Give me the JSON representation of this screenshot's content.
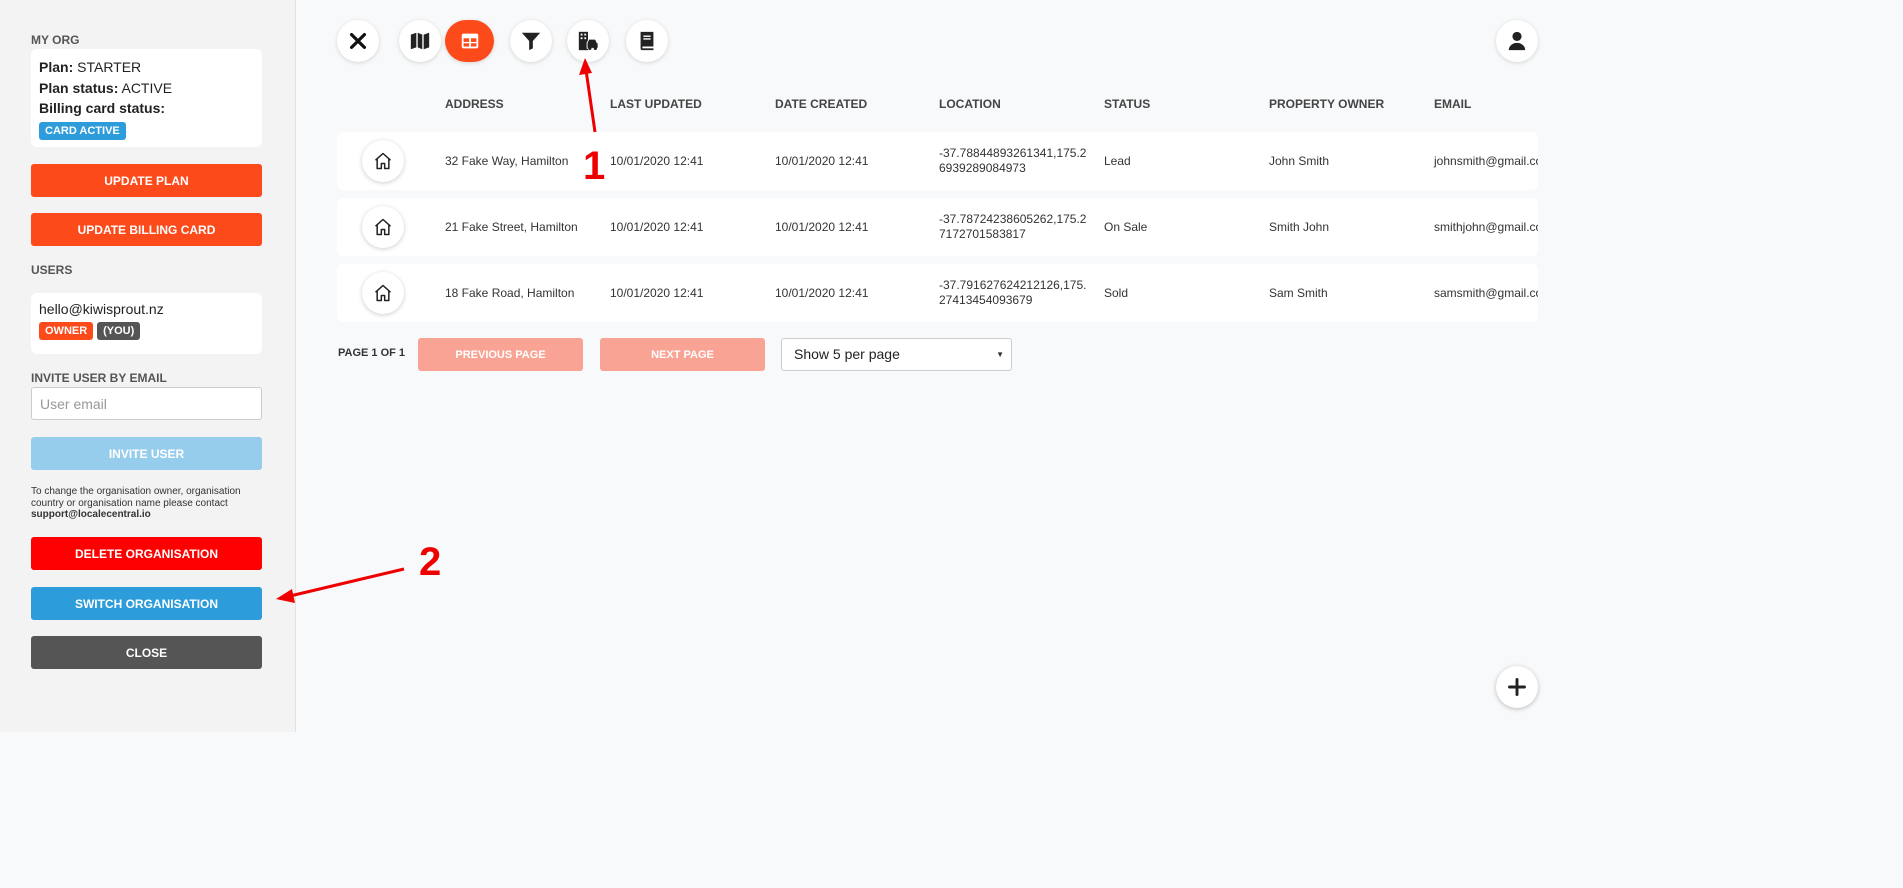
{
  "sidebar": {
    "my_org_label": "MY ORG",
    "plan_label": "Plan:",
    "plan_value": "STARTER",
    "plan_status_label": "Plan status:",
    "plan_status_value": "ACTIVE",
    "billing_status_label": "Billing card status:",
    "billing_badge": "CARD ACTIVE",
    "update_plan_button": "UPDATE PLAN",
    "update_billing_button": "UPDATE BILLING CARD",
    "users_label": "USERS",
    "user_email": "hello@kiwisprout.nz",
    "owner_badge": "OWNER",
    "you_badge": "(YOU)",
    "invite_label": "INVITE USER BY EMAIL",
    "invite_placeholder": "User email",
    "invite_button": "INVITE USER",
    "help_text": "To change the organisation owner, organisation country or organisation name please contact",
    "help_email": "support@localecentral.io",
    "delete_button": "DELETE ORGANISATION",
    "switch_button": "SWITCH ORGANISATION",
    "close_button": "CLOSE"
  },
  "toolbar": {
    "icons": [
      "close-icon",
      "map-icon",
      "table-icon",
      "filter-icon",
      "building-car-icon",
      "book-icon"
    ],
    "active": "table-icon",
    "user_icon": "user-icon"
  },
  "table": {
    "columns": [
      "ADDRESS",
      "LAST UPDATED",
      "DATE CREATED",
      "LOCATION",
      "STATUS",
      "PROPERTY OWNER",
      "EMAIL"
    ],
    "rows": [
      {
        "address": "32 Fake Way, Hamilton",
        "last_updated": "10/01/2020 12:41",
        "date_created": "10/01/2020 12:41",
        "location": "-37.78844893261341,175.26939289084973",
        "status": "Lead",
        "owner": "John Smith",
        "email": "johnsmith@gmail.com"
      },
      {
        "address": "21 Fake Street, Hamilton",
        "last_updated": "10/01/2020 12:41",
        "date_created": "10/01/2020 12:41",
        "location": "-37.78724238605262,175.27172701583817",
        "status": "On Sale",
        "owner": "Smith John",
        "email": "smithjohn@gmail.com"
      },
      {
        "address": "18 Fake Road, Hamilton",
        "last_updated": "10/01/2020 12:41",
        "date_created": "10/01/2020 12:41",
        "location": "-37.791627624212126,175.27413454093679",
        "status": "Sold",
        "owner": "Sam Smith",
        "email": "samsmith@gmail.com"
      }
    ]
  },
  "pagination": {
    "label": "PAGE 1 OF 1",
    "previous": "PREVIOUS PAGE",
    "next": "NEXT PAGE",
    "per_page": "Show 5 per page"
  },
  "annotations": {
    "one": "1",
    "two": "2"
  },
  "colors": {
    "accent": "#fc4a1a",
    "blue": "#2d9cdb",
    "light_blue": "#97cdec",
    "delete_red": "#ff0000",
    "dark": "#555555",
    "disabled_accent": "#f9a395"
  }
}
